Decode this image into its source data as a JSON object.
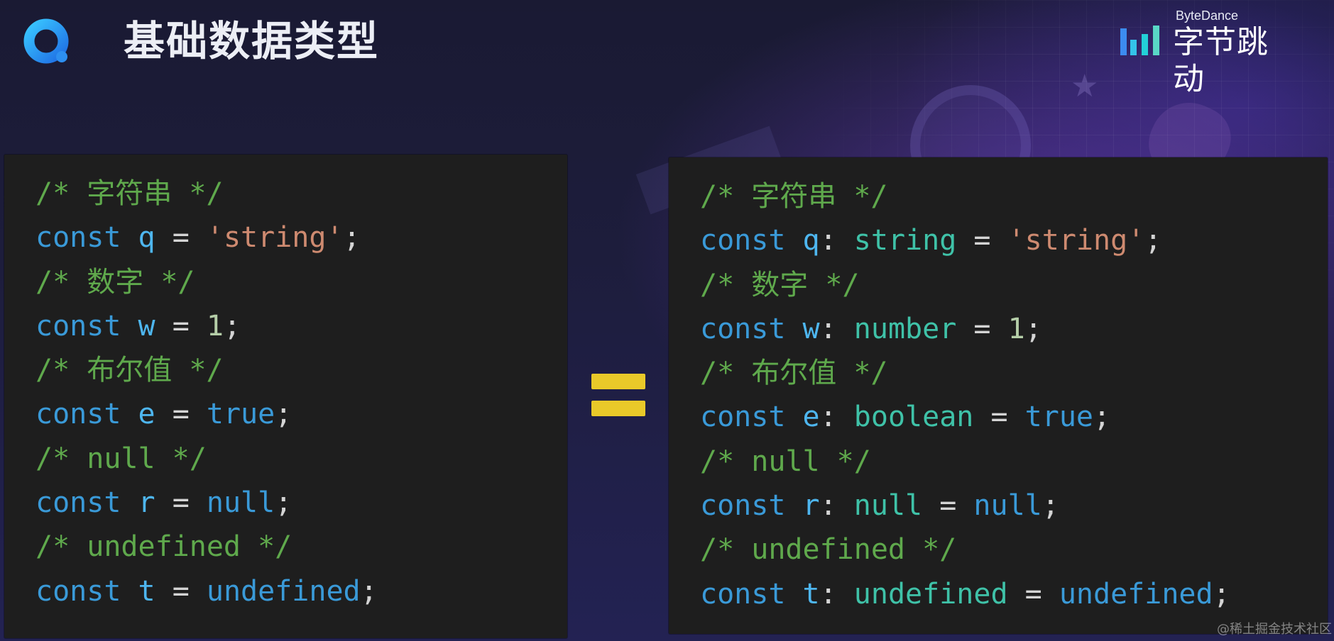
{
  "header": {
    "title": "基础数据类型",
    "logo_icon": "quick-q-icon"
  },
  "brand": {
    "name_en": "ByteDance",
    "name_cn": "字节跳动"
  },
  "colors": {
    "comment": "#5fa94c",
    "keyword": "#3a9ad8",
    "identifier": "#4eb6ef",
    "type": "#3fc2a8",
    "string": "#ce8a70",
    "number": "#b5cea8",
    "equals_sign": "#e9c929",
    "panel_background": "#1e1e1e"
  },
  "left_code": [
    {
      "comment": "/* 字符串 */"
    },
    {
      "kw": "const",
      "name": "q",
      "eq": "=",
      "value": "'string'",
      "value_kind": "str",
      "semi": ";"
    },
    {
      "comment": "/* 数字 */"
    },
    {
      "kw": "const",
      "name": "w",
      "eq": "=",
      "value": "1",
      "value_kind": "num",
      "semi": ";"
    },
    {
      "comment": "/* 布尔值 */"
    },
    {
      "kw": "const",
      "name": "e",
      "eq": "=",
      "value": "true",
      "value_kind": "lit",
      "semi": ";"
    },
    {
      "comment": "/* null */"
    },
    {
      "kw": "const",
      "name": "r",
      "eq": "=",
      "value": "null",
      "value_kind": "lit",
      "semi": ";"
    },
    {
      "comment": "/* undefined */"
    },
    {
      "kw": "const",
      "name": "t",
      "eq": "=",
      "value": "undefined",
      "value_kind": "lit",
      "semi": ";"
    }
  ],
  "equals_icon": "equals-sign-icon",
  "right_code": [
    {
      "comment": "/* 字符串 */"
    },
    {
      "kw": "const",
      "name": "q",
      "colon": ":",
      "type": "string",
      "eq": "=",
      "value": "'string'",
      "value_kind": "str",
      "semi": ";"
    },
    {
      "comment": "/* 数字 */"
    },
    {
      "kw": "const",
      "name": "w",
      "colon": ":",
      "type": "number",
      "eq": "=",
      "value": "1",
      "value_kind": "num",
      "semi": ";"
    },
    {
      "comment": "/* 布尔值 */"
    },
    {
      "kw": "const",
      "name": "e",
      "colon": ":",
      "type": "boolean",
      "eq": "=",
      "value": "true",
      "value_kind": "lit",
      "semi": ";"
    },
    {
      "comment": "/* null */"
    },
    {
      "kw": "const",
      "name": "r",
      "colon": ":",
      "type": "null",
      "eq": "=",
      "value": "null",
      "value_kind": "lit",
      "semi": ";"
    },
    {
      "comment": "/* undefined */"
    },
    {
      "kw": "const",
      "name": "t",
      "colon": ":",
      "type": "undefined",
      "eq": "=",
      "value": "undefined",
      "value_kind": "lit",
      "semi": ";"
    }
  ],
  "watermark": "@稀土掘金技术社区"
}
